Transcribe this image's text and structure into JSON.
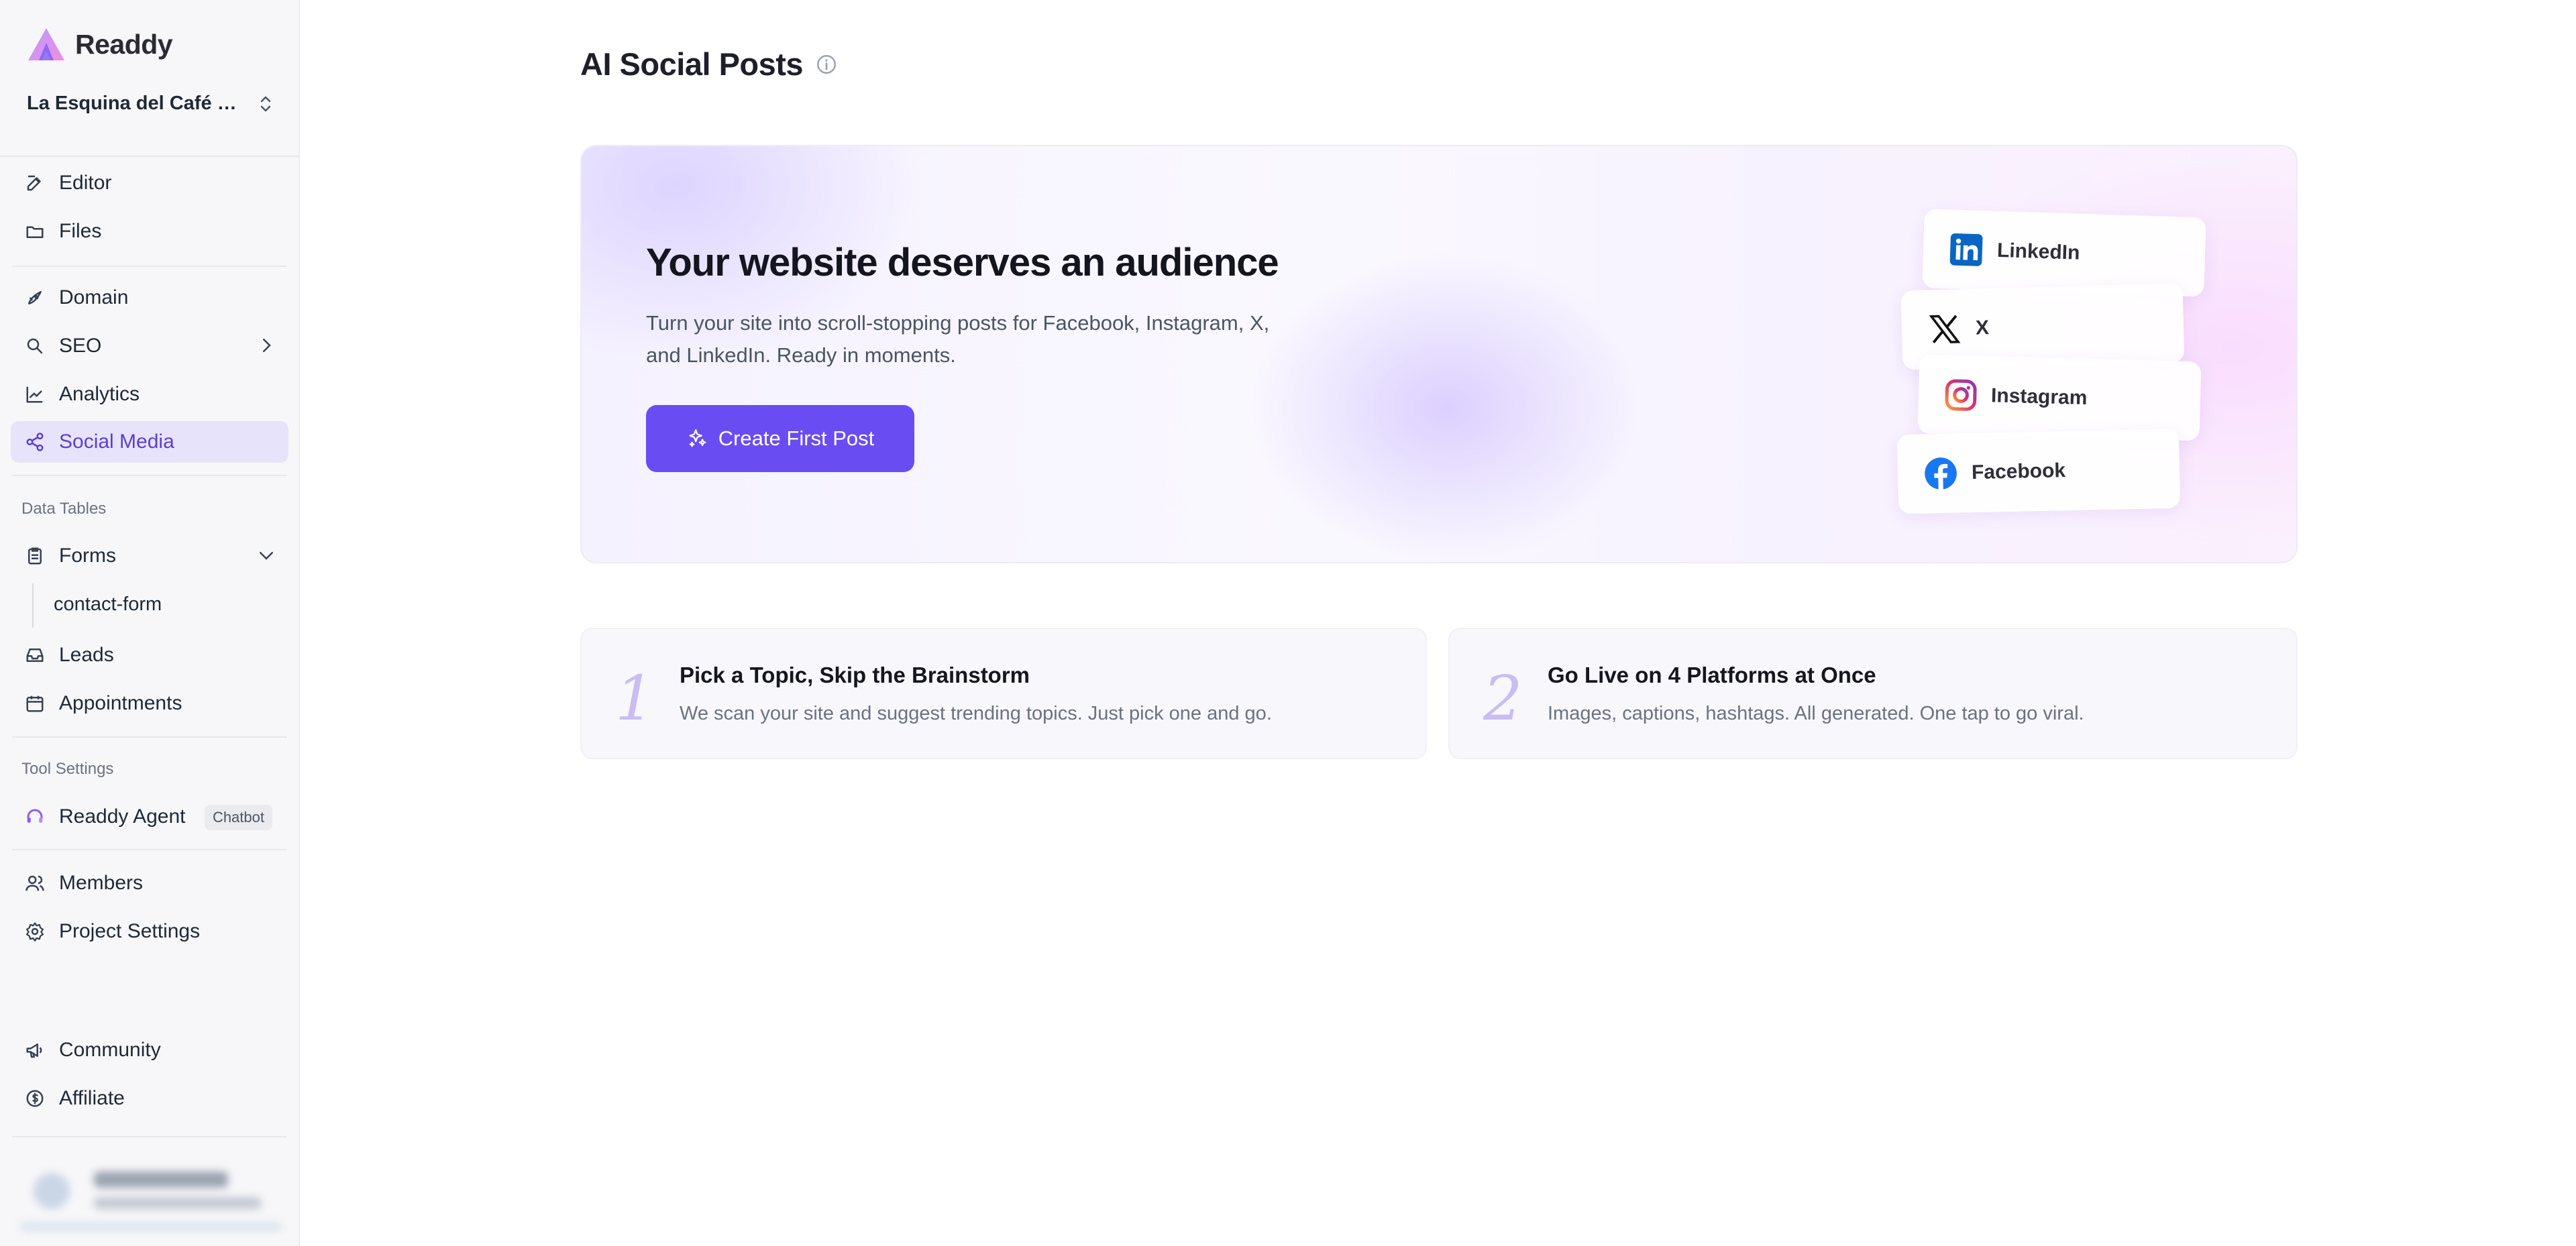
{
  "app": {
    "name": "Readdy"
  },
  "project": {
    "name": "La Esquina del Café – ..."
  },
  "sidebar": {
    "items_top": [
      {
        "label": "Editor",
        "icon": "edit-icon"
      },
      {
        "label": "Files",
        "icon": "folder-icon"
      },
      {
        "label": "Domain",
        "icon": "rocket-icon"
      },
      {
        "label": "SEO",
        "icon": "search-icon"
      },
      {
        "label": "Analytics",
        "icon": "chart-line-icon"
      },
      {
        "label": "Social Media",
        "icon": "share-icon",
        "active": true
      }
    ],
    "data_tables_label": "Data Tables",
    "data_tables": {
      "forms_label": "Forms",
      "form_items": [
        "contact-form"
      ],
      "leads_label": "Leads",
      "appointments_label": "Appointments"
    },
    "tool_settings_label": "Tool Settings",
    "agent": {
      "label": "Readdy Agent",
      "badge": "Chatbot"
    },
    "members_label": "Members",
    "project_settings_label": "Project Settings",
    "community_label": "Community",
    "affiliate_label": "Affiliate"
  },
  "main": {
    "title": "AI Social Posts",
    "hero": {
      "title": "Your website deserves an audience",
      "description": "Turn your site into scroll-stopping posts for Facebook, Instagram, X, and LinkedIn. Ready in moments.",
      "cta_label": "Create First Post",
      "platforms": [
        "LinkedIn",
        "X",
        "Instagram",
        "Facebook"
      ]
    },
    "steps": [
      {
        "num": "1",
        "title": "Pick a Topic, Skip the Brainstorm",
        "desc": "We scan your site and suggest trending topics. Just pick one and go."
      },
      {
        "num": "2",
        "title": "Go Live on 4 Platforms at Once",
        "desc": "Images, captions, hashtags. All generated. One tap to go viral."
      }
    ]
  },
  "colors": {
    "accent": "#6a4cf3",
    "active_bg": "#e7e3fb",
    "active_text": "#5b3fd1"
  }
}
